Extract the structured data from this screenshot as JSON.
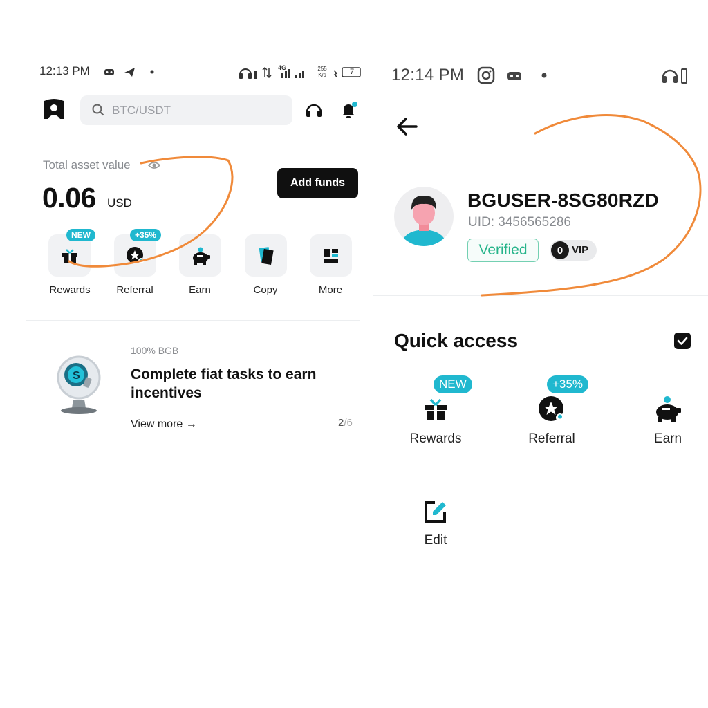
{
  "left_screen": {
    "status": {
      "time": "12:13 PM",
      "network": "4G",
      "speed_value": "255",
      "speed_unit": "K/s",
      "battery": "7"
    },
    "search": {
      "placeholder": "BTC/USDT"
    },
    "asset": {
      "label": "Total asset value",
      "value": "0.06",
      "currency": "USD"
    },
    "add_funds_label": "Add funds",
    "quick_items": [
      {
        "label": "Rewards",
        "badge": "NEW",
        "icon": "gift-icon"
      },
      {
        "label": "Referral",
        "badge": "+35%",
        "icon": "referral-star-icon"
      },
      {
        "label": "Earn",
        "badge": "",
        "icon": "piggy-bank-icon"
      },
      {
        "label": "Copy",
        "badge": "",
        "icon": "copy-cards-icon"
      },
      {
        "label": "More",
        "badge": "",
        "icon": "grid-more-icon"
      }
    ],
    "promo": {
      "tag": "100% BGB",
      "title": "Complete fiat tasks to earn incentives",
      "link": "View more →",
      "page_current": "2",
      "page_total": "/6"
    }
  },
  "right_screen": {
    "status": {
      "time": "12:14 PM"
    },
    "profile": {
      "username": "BGUSER-8SG80RZD",
      "uid": "UID: 3456565286",
      "verified": "Verified",
      "vip_level": "0",
      "vip_label": "VIP"
    },
    "quick_access": {
      "title": "Quick access",
      "items": [
        {
          "label": "Rewards",
          "badge": "NEW",
          "icon": "gift-icon"
        },
        {
          "label": "Referral",
          "badge": "+35%",
          "icon": "referral-star-icon"
        },
        {
          "label": "Earn",
          "badge": "",
          "icon": "piggy-bank-icon"
        }
      ],
      "edit_label": "Edit"
    }
  },
  "colors": {
    "accent_teal": "#20b8cf",
    "verified_green": "#26b48a",
    "annotation_orange": "#f08a3a",
    "button_dark": "#101010"
  }
}
